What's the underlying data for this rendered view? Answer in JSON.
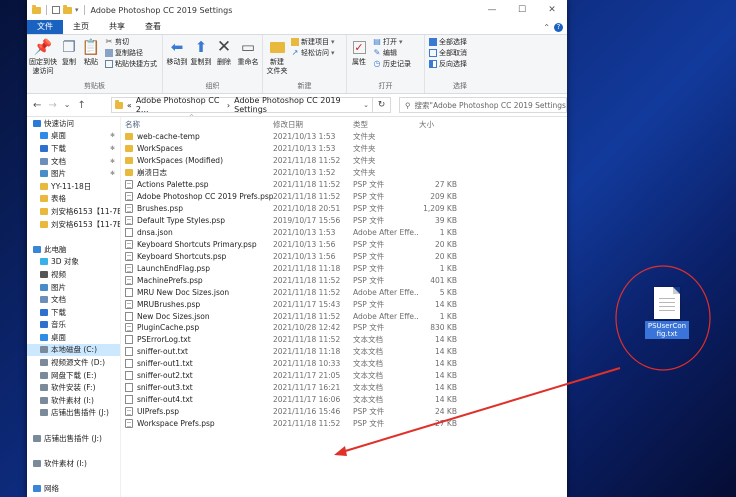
{
  "window": {
    "title": "Adobe Photoshop CC 2019 Settings",
    "controls": {
      "minimize": "—",
      "maximize": "☐",
      "close": "✕"
    }
  },
  "ribbon_tabs": [
    "文件",
    "主页",
    "共享",
    "查看"
  ],
  "ribbon": {
    "clipboard": {
      "pin_label": "固定到快\n速访问",
      "copy_label": "复制",
      "paste_label": "粘贴",
      "cut_label": "剪切",
      "copy_path_label": "复制路径",
      "paste_shortcut_label": "粘贴快捷方式",
      "group_label": "剪贴板"
    },
    "organize": {
      "move_to_label": "移动到",
      "copy_to_label": "复制到",
      "delete_label": "删除",
      "rename_label": "重命名",
      "group_label": "组织"
    },
    "new": {
      "new_folder_label": "新建\n文件夹",
      "new_item_label": "新建项目",
      "easy_access_label": "轻松访问",
      "group_label": "新建"
    },
    "open": {
      "properties_label": "属性",
      "open_label": "打开",
      "edit_label": "编辑",
      "history_label": "历史记录",
      "group_label": "打开"
    },
    "select": {
      "select_all_label": "全部选择",
      "select_none_label": "全部取消",
      "invert_label": "反向选择",
      "group_label": "选择"
    }
  },
  "address": {
    "path_prefix": "«",
    "path_parts": [
      "Adobe Photoshop CC 2...",
      "Adobe Photoshop CC 2019 Settings"
    ],
    "path_sep": "›",
    "search_placeholder": "搜索\"Adobe Photoshop CC 2019 Settings\""
  },
  "nav_pane": [
    {
      "label": "快速访问",
      "icon": "star-icon",
      "color": "#2b7ad6",
      "indent": 0
    },
    {
      "label": "桌面",
      "icon": "desktop-icon",
      "color": "#2e8ce8",
      "indent": 1,
      "pinned": true
    },
    {
      "label": "下载",
      "icon": "download-icon",
      "color": "#2e6fd0",
      "indent": 1,
      "pinned": true
    },
    {
      "label": "文档",
      "icon": "document-icon",
      "color": "#6b8fb8",
      "indent": 1,
      "pinned": true
    },
    {
      "label": "图片",
      "icon": "pictures-icon",
      "color": "#4a8cc8",
      "indent": 1,
      "pinned": true
    },
    {
      "label": "YY-11-18日",
      "icon": "folder-icon",
      "color": "#e8b93c",
      "indent": 1
    },
    {
      "label": "表格",
      "icon": "folder-icon",
      "color": "#e8b93c",
      "indent": 1
    },
    {
      "label": "刘安格6153【11-7E",
      "icon": "folder-icon",
      "color": "#e8b93c",
      "indent": 1
    },
    {
      "label": "刘安格6153【11-7E",
      "icon": "folder-icon",
      "color": "#e8b93c",
      "indent": 1
    },
    {
      "label": "",
      "icon": "",
      "color": "",
      "indent": 0
    },
    {
      "label": "此电脑",
      "icon": "computer-icon",
      "color": "#3a86d6",
      "indent": 0
    },
    {
      "label": "3D 对象",
      "icon": "3d-objects-icon",
      "color": "#3ab0e8",
      "indent": 1
    },
    {
      "label": "视频",
      "icon": "video-icon",
      "color": "#555",
      "indent": 1
    },
    {
      "label": "图片",
      "icon": "pictures-icon",
      "color": "#4a8cc8",
      "indent": 1
    },
    {
      "label": "文档",
      "icon": "document-icon",
      "color": "#6b8fb8",
      "indent": 1
    },
    {
      "label": "下载",
      "icon": "download-icon",
      "color": "#2e6fd0",
      "indent": 1
    },
    {
      "label": "音乐",
      "icon": "music-icon",
      "color": "#2e6fd0",
      "indent": 1
    },
    {
      "label": "桌面",
      "icon": "desktop-icon",
      "color": "#2e8ce8",
      "indent": 1
    },
    {
      "label": "本地磁盘 (C:)",
      "icon": "drive-icon",
      "color": "#7a8a9a",
      "indent": 1,
      "selected": true
    },
    {
      "label": "视频源文件 (D:)",
      "icon": "drive-icon",
      "color": "#7a8a9a",
      "indent": 1
    },
    {
      "label": "网盘下载 (E:)",
      "icon": "drive-icon",
      "color": "#7a8a9a",
      "indent": 1
    },
    {
      "label": "软件安装 (F:)",
      "icon": "drive-icon",
      "color": "#7a8a9a",
      "indent": 1
    },
    {
      "label": "软件素材 (I:)",
      "icon": "drive-icon",
      "color": "#7a8a9a",
      "indent": 1
    },
    {
      "label": "店铺出售插件 (J:)",
      "icon": "drive-icon",
      "color": "#7a8a9a",
      "indent": 1
    },
    {
      "label": "",
      "icon": "",
      "color": "",
      "indent": 0
    },
    {
      "label": "店铺出售插件 (J:)",
      "icon": "drive-icon",
      "color": "#7a8a9a",
      "indent": 0
    },
    {
      "label": "",
      "icon": "",
      "color": "",
      "indent": 0
    },
    {
      "label": "软件素材 (I:)",
      "icon": "drive-icon",
      "color": "#7a8a9a",
      "indent": 0
    },
    {
      "label": "",
      "icon": "",
      "color": "",
      "indent": 0
    },
    {
      "label": "网络",
      "icon": "network-icon",
      "color": "#3a86d6",
      "indent": 0
    }
  ],
  "columns": {
    "name": "名称",
    "date": "修改日期",
    "type": "类型",
    "size": "大小"
  },
  "files": [
    {
      "name": "web-cache-temp",
      "date": "2021/10/13 1:53",
      "type": "文件夹",
      "size": "",
      "kind": "folder"
    },
    {
      "name": "WorkSpaces",
      "date": "2021/10/13 1:53",
      "type": "文件夹",
      "size": "",
      "kind": "folder"
    },
    {
      "name": "WorkSpaces (Modified)",
      "date": "2021/11/18 11:52",
      "type": "文件夹",
      "size": "",
      "kind": "folder"
    },
    {
      "name": "崩溃日志",
      "date": "2021/10/13 1:52",
      "type": "文件夹",
      "size": "",
      "kind": "folder"
    },
    {
      "name": "Actions Palette.psp",
      "date": "2021/11/18 11:52",
      "type": "PSP 文件",
      "size": "27 KB",
      "kind": "file"
    },
    {
      "name": "Adobe Photoshop CC 2019 Prefs.psp",
      "date": "2021/11/18 11:52",
      "type": "PSP 文件",
      "size": "209 KB",
      "kind": "file"
    },
    {
      "name": "Brushes.psp",
      "date": "2021/10/18 20:51",
      "type": "PSP 文件",
      "size": "1,209 KB",
      "kind": "file"
    },
    {
      "name": "Default Type Styles.psp",
      "date": "2019/10/17 15:56",
      "type": "PSP 文件",
      "size": "39 KB",
      "kind": "file"
    },
    {
      "name": "dnsa.json",
      "date": "2021/10/13 1:53",
      "type": "Adobe After Effe...",
      "size": "1 KB",
      "kind": "ae"
    },
    {
      "name": "Keyboard Shortcuts Primary.psp",
      "date": "2021/10/13 1:56",
      "type": "PSP 文件",
      "size": "20 KB",
      "kind": "file"
    },
    {
      "name": "Keyboard Shortcuts.psp",
      "date": "2021/10/13 1:56",
      "type": "PSP 文件",
      "size": "20 KB",
      "kind": "file"
    },
    {
      "name": "LaunchEndFlag.psp",
      "date": "2021/11/18 11:18",
      "type": "PSP 文件",
      "size": "1 KB",
      "kind": "file"
    },
    {
      "name": "MachinePrefs.psp",
      "date": "2021/11/18 11:52",
      "type": "PSP 文件",
      "size": "401 KB",
      "kind": "file"
    },
    {
      "name": "MRU New Doc Sizes.json",
      "date": "2021/11/18 11:52",
      "type": "Adobe After Effe...",
      "size": "5 KB",
      "kind": "ae"
    },
    {
      "name": "MRUBrushes.psp",
      "date": "2021/11/17 15:43",
      "type": "PSP 文件",
      "size": "14 KB",
      "kind": "file"
    },
    {
      "name": "New Doc Sizes.json",
      "date": "2021/11/18 11:52",
      "type": "Adobe After Effe...",
      "size": "1 KB",
      "kind": "ae"
    },
    {
      "name": "PluginCache.psp",
      "date": "2021/10/28 12:42",
      "type": "PSP 文件",
      "size": "830 KB",
      "kind": "file"
    },
    {
      "name": "PSErrorLog.txt",
      "date": "2021/11/18 11:52",
      "type": "文本文档",
      "size": "14 KB",
      "kind": "txt"
    },
    {
      "name": "sniffer-out.txt",
      "date": "2021/11/18 11:18",
      "type": "文本文档",
      "size": "14 KB",
      "kind": "txt"
    },
    {
      "name": "sniffer-out1.txt",
      "date": "2021/11/18 10:33",
      "type": "文本文档",
      "size": "14 KB",
      "kind": "txt"
    },
    {
      "name": "sniffer-out2.txt",
      "date": "2021/11/17 21:05",
      "type": "文本文档",
      "size": "14 KB",
      "kind": "txt"
    },
    {
      "name": "sniffer-out3.txt",
      "date": "2021/11/17 16:21",
      "type": "文本文档",
      "size": "14 KB",
      "kind": "txt"
    },
    {
      "name": "sniffer-out4.txt",
      "date": "2021/11/17 16:06",
      "type": "文本文档",
      "size": "14 KB",
      "kind": "txt"
    },
    {
      "name": "UIPrefs.psp",
      "date": "2021/11/16 15:46",
      "type": "PSP 文件",
      "size": "24 KB",
      "kind": "file"
    },
    {
      "name": "Workspace Prefs.psp",
      "date": "2021/11/18 11:52",
      "type": "PSP 文件",
      "size": "27 KB",
      "kind": "file"
    }
  ],
  "desktop_icon": {
    "label": "PSUserConfig.txt"
  },
  "colors": {
    "accent": "#1a62c0",
    "selected": "#cce8ff",
    "annotation": "#e0302a"
  }
}
